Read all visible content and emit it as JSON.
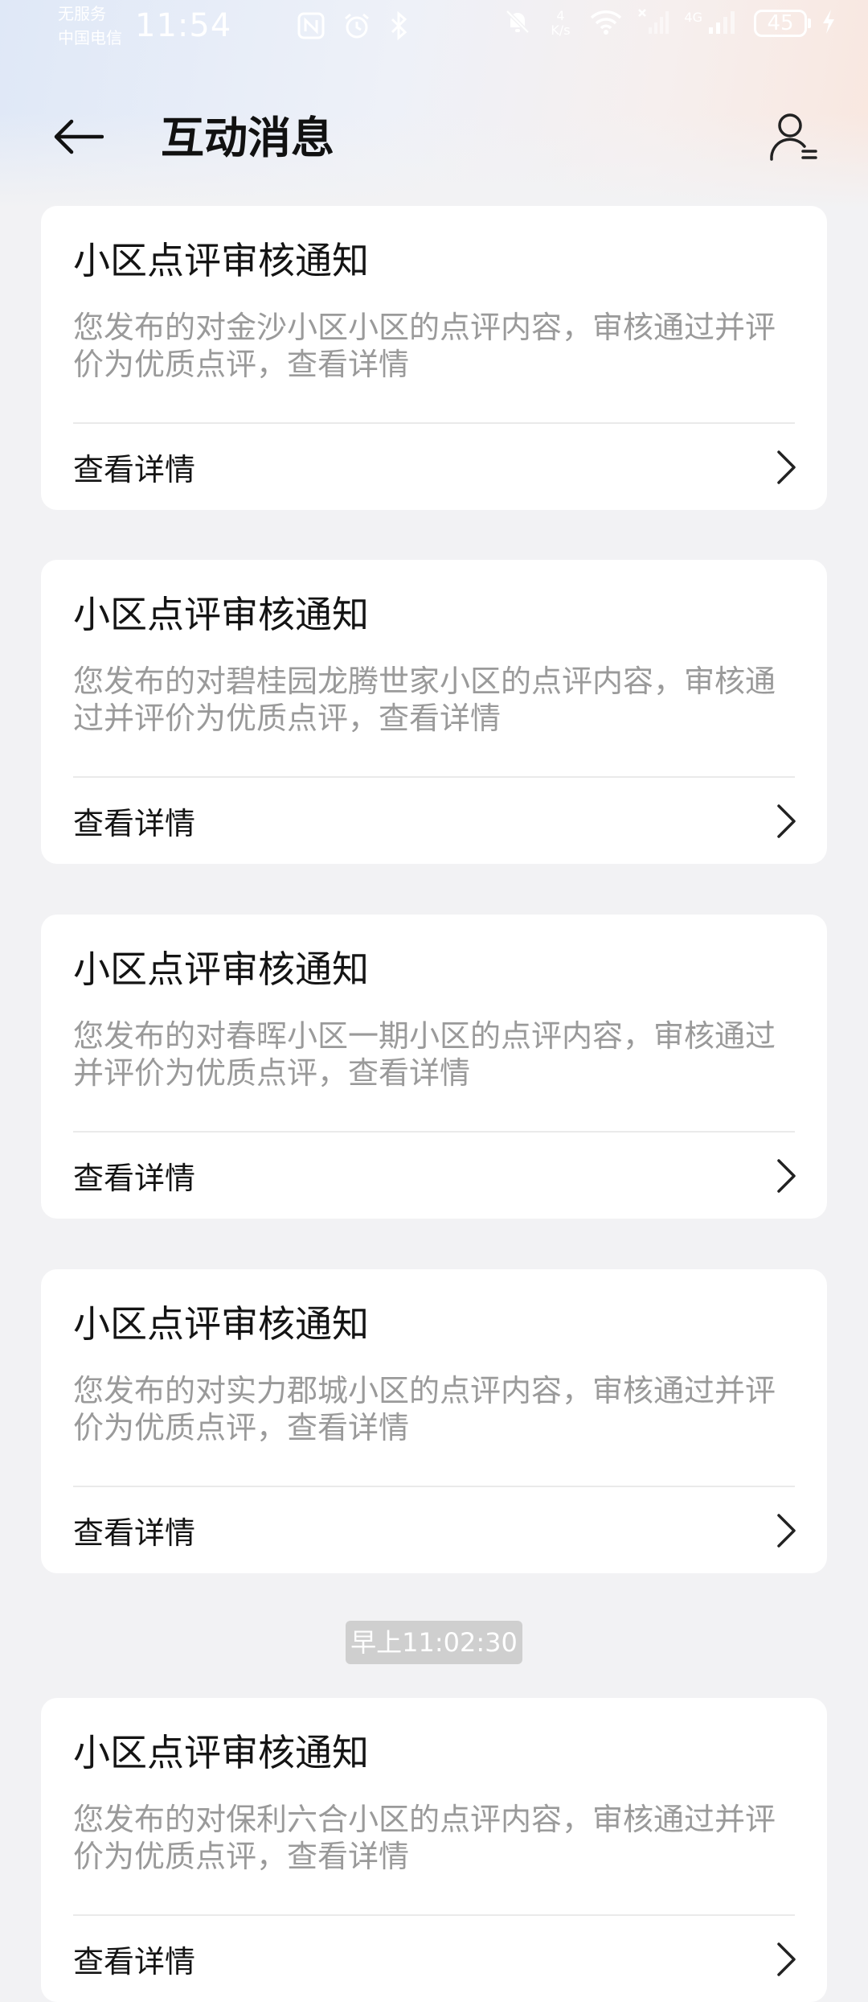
{
  "status_bar": {
    "carrier_line1": "无服务",
    "carrier_line2": "中国电信",
    "time": "11:54",
    "net_speed_value": "4",
    "net_speed_unit": "K/s",
    "network_type": "4G",
    "battery": "45"
  },
  "header": {
    "title": "互动消息"
  },
  "messages": [
    {
      "title": "小区点评审核通知",
      "body": "您发布的对金沙小区小区的点评内容，审核通过并评价为优质点评，查看详情",
      "link": "查看详情"
    },
    {
      "title": "小区点评审核通知",
      "body": "您发布的对碧桂园龙腾世家小区的点评内容，审核通过并评价为优质点评，查看详情",
      "link": "查看详情"
    },
    {
      "title": "小区点评审核通知",
      "body": "您发布的对春晖小区一期小区的点评内容，审核通过并评价为优质点评，查看详情",
      "link": "查看详情"
    },
    {
      "title": "小区点评审核通知",
      "body": "您发布的对实力郡城小区的点评内容，审核通过并评价为优质点评，查看详情",
      "link": "查看详情"
    },
    {
      "title": "小区点评审核通知",
      "body": "您发布的对保利六合小区的点评内容，审核通过并评价为优质点评，查看详情",
      "link": "查看详情"
    }
  ],
  "timestamp": "早上11:02:30",
  "icons": {
    "back": "back-arrow-icon",
    "user_settings": "user-settings-icon",
    "chevron": "chevron-right-icon"
  }
}
